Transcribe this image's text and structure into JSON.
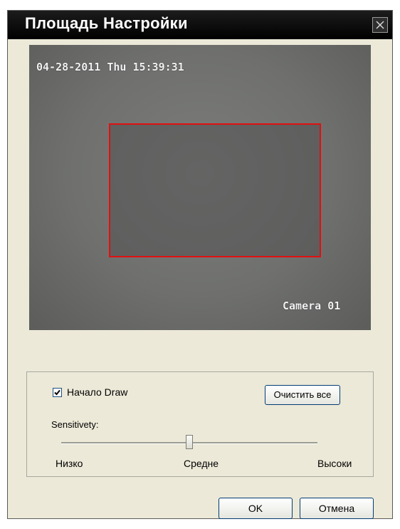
{
  "window": {
    "title": "Площадь Настройки",
    "close_icon": "close-icon"
  },
  "video": {
    "timestamp": "04-28-2011 Thu 15:39:31",
    "camera_label": "Camera 01",
    "region_color": "#e01010"
  },
  "controls": {
    "draw_checkbox": {
      "label": "Начало Draw",
      "checked": true
    },
    "clear_all_label": "Очистить все",
    "sensitivity_label": "Sensitivety:",
    "sensitivity_level_fraction": 0.5,
    "scale": {
      "low": "Низко",
      "mid": "Средне",
      "high": "Высоки"
    }
  },
  "footer": {
    "ok_label": "OK",
    "cancel_label": "Отмена"
  }
}
